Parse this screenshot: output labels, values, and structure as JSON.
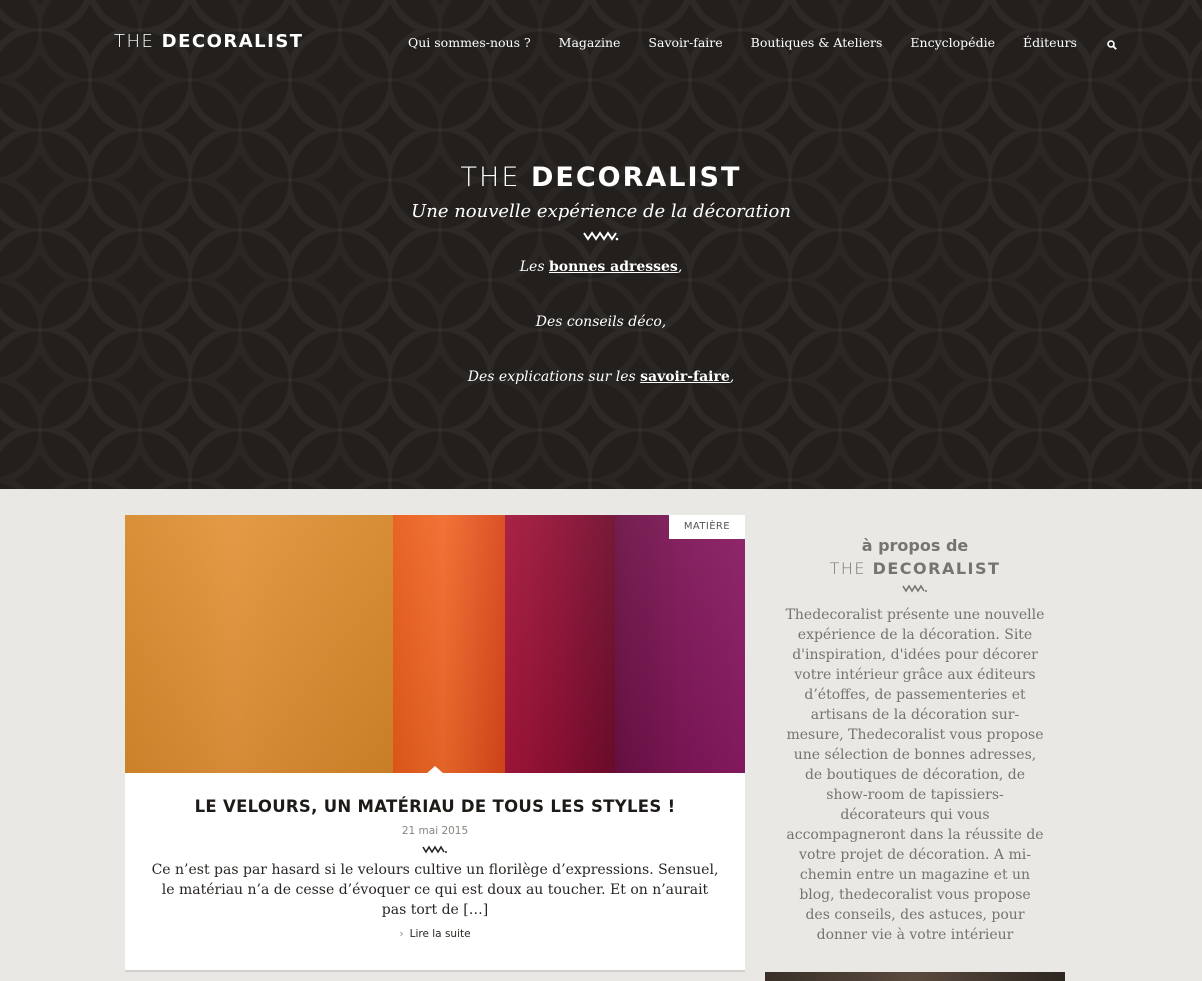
{
  "site": {
    "logo_the": "THE",
    "logo_brand": "DECORALIST"
  },
  "nav": {
    "items": [
      {
        "label": "Qui sommes-nous ?"
      },
      {
        "label": "Magazine"
      },
      {
        "label": "Savoir-faire"
      },
      {
        "label": "Boutiques & Ateliers"
      },
      {
        "label": "Encyclopédie"
      },
      {
        "label": "Éditeurs"
      }
    ],
    "search_icon": "search-icon"
  },
  "hero": {
    "logo_the": "THE",
    "logo_brand": "DECORALIST",
    "tagline": "Une nouvelle expérience de la décoration",
    "line1_prefix": "Les",
    "line1_link": "bonnes adresses",
    "line1_suffix": ",",
    "line2": "Des conseils déco,",
    "line3_prefix": "Des explications sur les",
    "line3_link": "savoir-faire",
    "line3_suffix": ","
  },
  "article": {
    "tag": "MATIÈRE",
    "title": "LE VELOURS, UN MATÉRIAU DE TOUS LES STYLES !",
    "date": "21 mai 2015",
    "excerpt": "Ce n’est pas par hasard si le velours cultive un florilège d’expressions. Sensuel, le matériau n’a de cesse d’évoquer ce qui est doux au toucher. Et on n’aurait pas tort de […]",
    "read_more": "Lire la suite"
  },
  "about": {
    "heading": "à propos de",
    "logo_the": "THE",
    "logo_brand": "DECORALIST",
    "text": "Thedecoralist présente une nouvelle expérience de la décoration. Site d'inspiration, d'idées pour décorer votre intérieur grâce aux éditeurs d’étoffes, de passementeries et artisans de la décoration sur-mesure, Thedecoralist vous propose une sélection de bonnes adresses, de boutiques de décoration, de show-room de tapissiers-décorateurs qui vous accompagneront dans la réussite de votre projet de décoration. A mi-chemin entre un magazine et un blog, thedecoralist vous propose des conseils, des astuces, pour donner vie à votre intérieur"
  },
  "colors": {
    "hero_bg": "#231f1c",
    "page_bg": "#eae8e4",
    "sidebar_text": "#77736e"
  }
}
